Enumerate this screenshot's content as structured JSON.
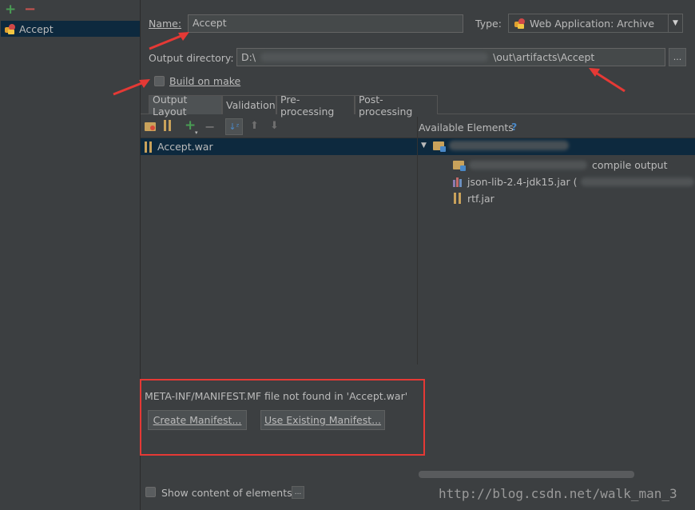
{
  "left_pane": {
    "add_label": "+",
    "remove_label": "−",
    "artifacts": [
      {
        "label": "Accept"
      }
    ]
  },
  "form": {
    "name_label": "Name:",
    "name_value": "Accept",
    "type_label": "Type:",
    "type_value": "Web Application: Archive",
    "output_dir_label": "Output directory:",
    "output_dir_prefix": "D:\\",
    "output_dir_suffix": "\\out\\artifacts\\Accept",
    "browse_label": "...",
    "build_on_make_label": "Build on make",
    "build_on_make_checked": false
  },
  "tabs": [
    {
      "label": "Output Layout",
      "active": true
    },
    {
      "label": "Validation",
      "active": false
    },
    {
      "label": "Pre-processing",
      "active": false
    },
    {
      "label": "Post-processing",
      "active": false
    }
  ],
  "layout_tree": {
    "root_label": "Accept.war"
  },
  "available_elements": {
    "header": "Available Elements",
    "help_icon": "?",
    "items": [
      {
        "label": "compile output",
        "icon": "folder-icon"
      },
      {
        "label": "json-lib-2.4-jdk15.jar (",
        "icon": "library-icon"
      },
      {
        "label": "rtf.jar",
        "icon": "jar-icon"
      }
    ]
  },
  "manifest": {
    "message": "META-INF/MANIFEST.MF file not found in 'Accept.war'",
    "create_button": "Create Manifest...",
    "use_existing_button": "Use Existing Manifest..."
  },
  "footer": {
    "show_content_label": "Show content of elements",
    "more_label": "..."
  },
  "watermark": "http://blog.csdn.net/walk_man_3",
  "colors": {
    "background": "#3c3f41",
    "selection": "#0d293e",
    "annotation": "#e53935"
  }
}
